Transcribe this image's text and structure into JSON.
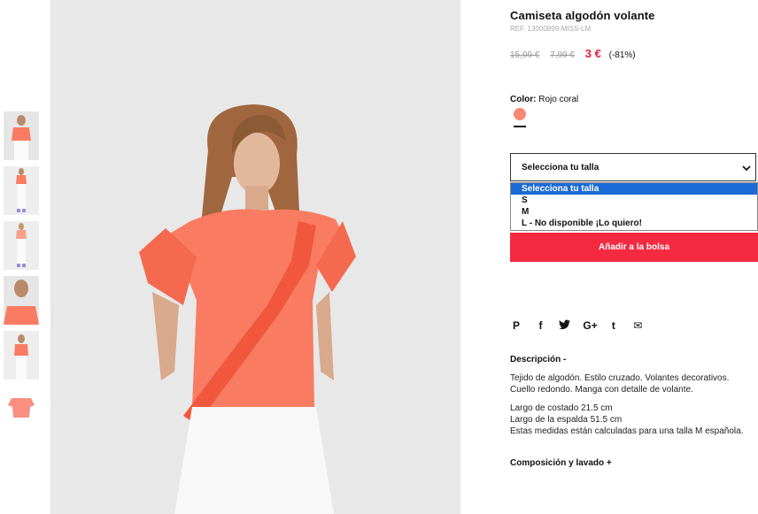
{
  "product": {
    "title": "Camiseta algodón volante",
    "ref": "REF. 13000899-MISS-LM",
    "price_original": "15,99 €",
    "price_previous": "7,99 €",
    "price_current": "3 €",
    "discount": "(-81%)"
  },
  "color": {
    "label": "Color:",
    "value": "Rojo coral",
    "swatch_hex": "#f98877"
  },
  "size": {
    "select_label": "Selecciona tu talla",
    "options": [
      "Selecciona tu talla",
      "S",
      "M",
      "L - No disponible ¡Lo quiero!"
    ]
  },
  "actions": {
    "add_to_bag": "Añadir a la bolsa"
  },
  "social": {
    "pinterest": "P",
    "facebook": "f",
    "twitter": "t",
    "googleplus": "G+",
    "tumblr": "t",
    "email": "✉"
  },
  "description": {
    "heading": "Descripción -",
    "line1": "Tejido de algodón. Estilo cruzado. Volantes decorativos.",
    "line2": "Cuello redondo. Manga con detalle de volante.",
    "line3": "Largo de costado 21.5 cm",
    "line4": "Largo de la espalda 51.5 cm",
    "line5": "Estas medidas están calculadas para una talla M española."
  },
  "composition": {
    "heading": "Composición y lavado +"
  },
  "colors": {
    "accent_red": "#f42a40",
    "price_red": "#e31e3c",
    "shirt_coral": "#f97c62",
    "select_blue": "#1a6bd6"
  }
}
